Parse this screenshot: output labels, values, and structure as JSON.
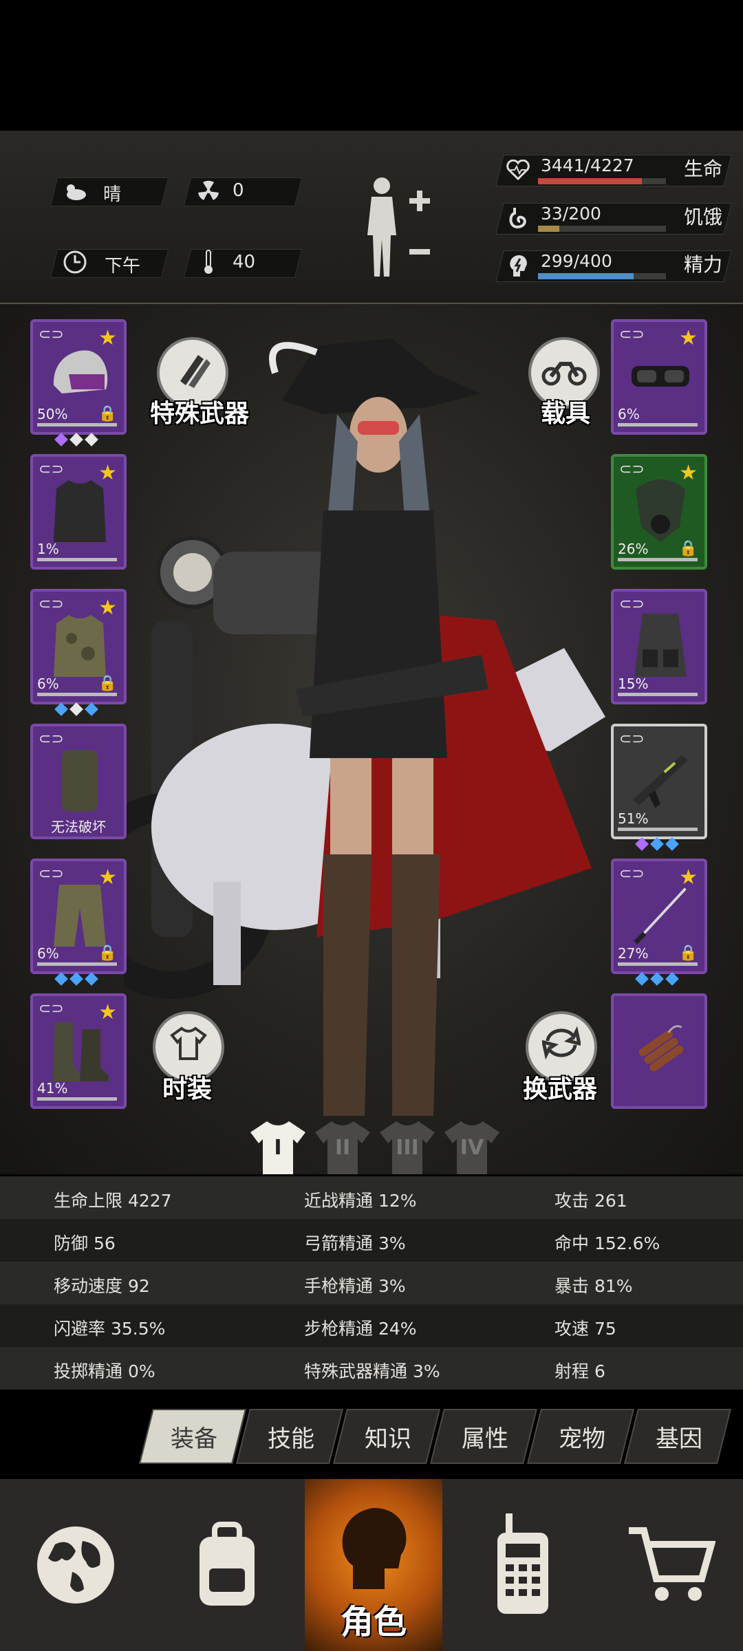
{
  "env": {
    "weather": "晴",
    "radiation": "0",
    "time_of_day": "下午",
    "temperature": "40"
  },
  "vitals": {
    "health": {
      "value": "3441/4227",
      "label": "生命",
      "fill": 0.814,
      "color": "#c8473c"
    },
    "hunger": {
      "value": "33/200",
      "label": "饥饿",
      "fill": 0.165,
      "color": "#a7894a"
    },
    "energy": {
      "value": "299/400",
      "label": "精力",
      "fill": 0.7475,
      "color": "#4d8fc7"
    }
  },
  "actions": {
    "special_weapon": "特殊武器",
    "vehicle": "载具",
    "fashion": "时装",
    "swap_weapon": "换武器"
  },
  "left_slots": [
    {
      "name": "police-helmet",
      "pct": "50%",
      "star": true,
      "lock": true,
      "gems": [
        "#b06cff",
        "#e8e8e8",
        "#e8e8e8"
      ]
    },
    {
      "name": "black-jacket",
      "pct": "1%",
      "star": true,
      "lock": false,
      "gems": []
    },
    {
      "name": "camo-jacket",
      "pct": "6%",
      "star": true,
      "lock": true,
      "gems": [
        "#4aa3ff",
        "#e8e8e8",
        "#4aa3ff"
      ]
    },
    {
      "name": "backpack-armor",
      "pct": "",
      "star": false,
      "lock": false,
      "note": "无法破坏",
      "gems": []
    },
    {
      "name": "camo-pants",
      "pct": "6%",
      "star": true,
      "lock": true,
      "gems": [
        "#4aa3ff",
        "#4aa3ff",
        "#4aa3ff"
      ]
    },
    {
      "name": "combat-boots",
      "pct": "41%",
      "star": true,
      "lock": false,
      "gems": []
    }
  ],
  "right_slots": [
    {
      "name": "goggles",
      "pct": "6%",
      "star": true,
      "lock": false,
      "gems": []
    },
    {
      "name": "gas-mask",
      "pct": "26%",
      "star": true,
      "lock": true,
      "gems": []
    },
    {
      "name": "tactical-vest",
      "pct": "15%",
      "star": false,
      "lock": false,
      "gems": []
    },
    {
      "name": "assault-rifle",
      "pct": "51%",
      "star": false,
      "lock": false,
      "gems": [
        "#b06cff",
        "#4aa3ff",
        "#4aa3ff"
      ]
    },
    {
      "name": "katana",
      "pct": "27%",
      "star": true,
      "lock": true,
      "gems": [
        "#4aa3ff",
        "#4aa3ff",
        "#4aa3ff"
      ]
    },
    {
      "name": "dynamite",
      "pct": "",
      "star": false,
      "lock": false,
      "gems": []
    }
  ],
  "outfits": [
    "I",
    "II",
    "III",
    "IV"
  ],
  "stats": [
    [
      "生命上限 4227",
      "近战精通 12%",
      "攻击 261"
    ],
    [
      "防御 56",
      "弓箭精通 3%",
      "命中 152.6%"
    ],
    [
      "移动速度 92",
      "手枪精通 3%",
      "暴击 81%"
    ],
    [
      "闪避率 35.5%",
      "步枪精通 24%",
      "攻速 75"
    ],
    [
      "投掷精通 0%",
      "特殊武器精通 3%",
      "射程 6"
    ]
  ],
  "tabs": [
    "装备",
    "技能",
    "知识",
    "属性",
    "宠物",
    "基因"
  ],
  "nav": {
    "character_label": "角色"
  }
}
